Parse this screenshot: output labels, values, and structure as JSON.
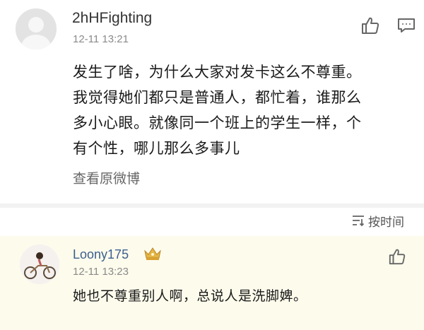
{
  "post": {
    "username": "2hHFighting",
    "timestamp": "12-11 13:21",
    "lines": [
      "发生了啥，为什么大家对发卡这么不尊重。",
      "我觉得她们都只是普通人，都忙着，谁那么",
      "多小心眼。就像同一个班上的学生一样，个",
      "有个性，哪儿那么多事儿"
    ],
    "view_original": "查看原微博",
    "icons": {
      "like": "thumbs-up-icon",
      "comment": "comment-icon",
      "avatar": "default-avatar-icon"
    }
  },
  "sort": {
    "label": "按时间",
    "icon": "sort-lines-icon"
  },
  "reply": {
    "username": "Loony175",
    "timestamp": "12-11 13:23",
    "text": "她也不尊重别人啊，总说人是洗脚婢。",
    "icons": {
      "vip": "crown-icon",
      "like": "thumbs-up-icon"
    }
  },
  "colors": {
    "reply_background": "#fdfbec",
    "reply_username": "#3b5f8e",
    "crown_gold": "#e5b544",
    "separator": "#f2f2f2"
  }
}
